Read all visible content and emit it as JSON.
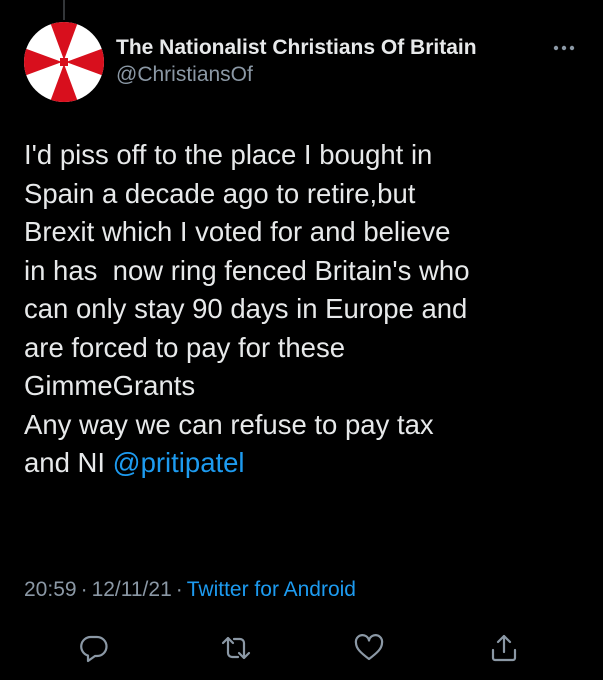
{
  "author": {
    "display_name": "The Nationalist Christians Of Britain",
    "handle": "@ChristiansOf",
    "avatar_icon": "red-cross-flag-icon",
    "avatar_colors": {
      "cross": "#d80f1d",
      "field": "#ffffff"
    }
  },
  "tweet": {
    "lines": [
      "I'd piss off to the place I bought in",
      "Spain a decade ago to retire,but",
      "Brexit which I voted for and believe",
      "in has  now ring fenced Britain's who",
      "can only stay 90 days in Europe and",
      "are forced to pay for these",
      "GimmeGrants",
      "Any way we can refuse to pay tax"
    ],
    "last_line_prefix": "and NI ",
    "mention": "@pritipatel"
  },
  "meta": {
    "time": "20:59",
    "separator": "·",
    "date": "12/11/21",
    "source": "Twitter for Android"
  },
  "actions": {
    "reply_icon": "reply-icon",
    "retweet_icon": "retweet-icon",
    "like_icon": "like-icon",
    "share_icon": "share-icon"
  },
  "colors": {
    "background": "#000000",
    "text": "#e7e9ea",
    "secondary": "#8b98a5",
    "accent": "#1d9bf0"
  }
}
